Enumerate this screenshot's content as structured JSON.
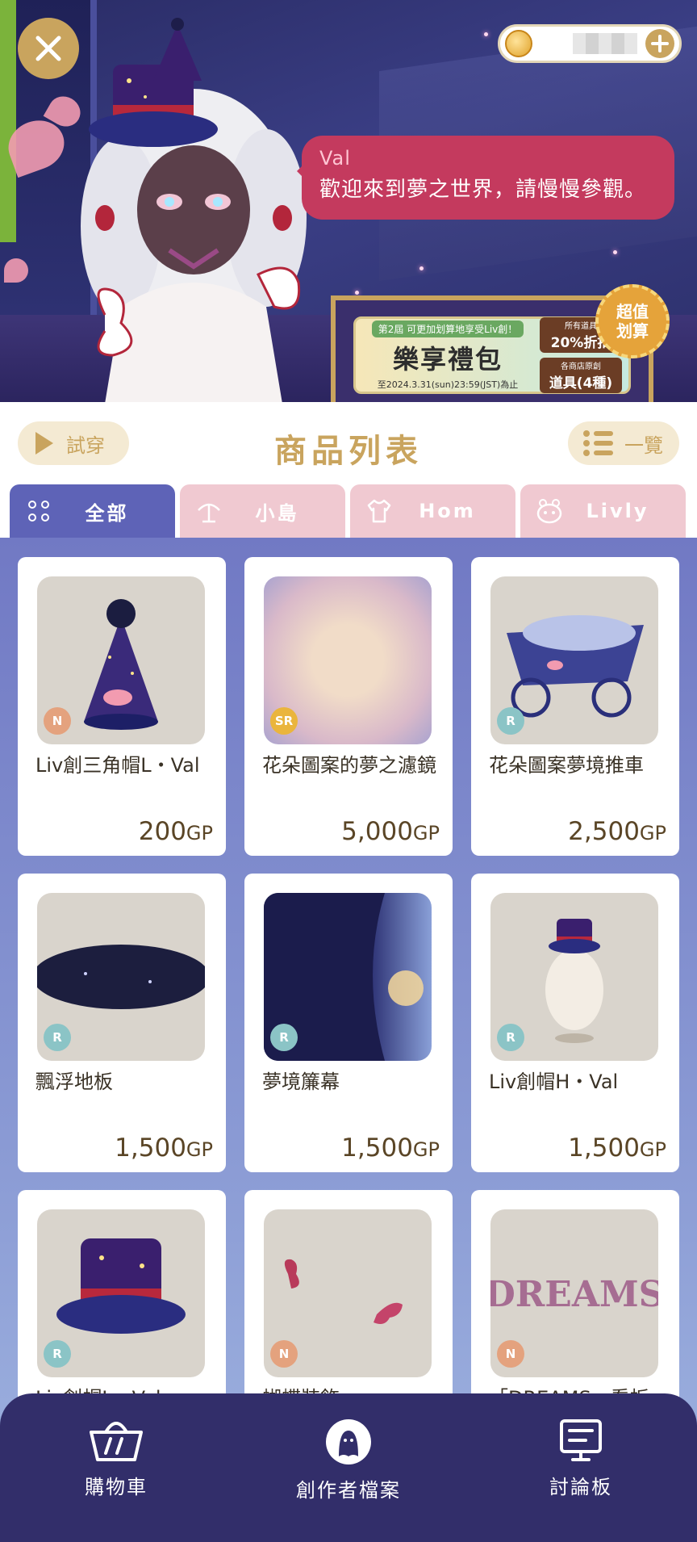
{
  "hero": {
    "speaker_name": "Val",
    "speech_text": "歡迎來到夢之世界，請慢慢參觀。",
    "close_icon": "close-icon",
    "coin_icon": "coin-icon",
    "plus_icon": "plus-icon"
  },
  "promo": {
    "tag": "第2屆 可更加划算地享受Liv創！",
    "title": "樂享禮包",
    "date": "至2024.3.31(sun)23:59(JST)為止",
    "box1_small": "所有道具",
    "box1_big": "20%折扣",
    "box2_small": "各商店原創",
    "box2_big": "道具(4種)",
    "badge_line1": "超值",
    "badge_line2": "划算"
  },
  "header": {
    "tryon_label": "試穿",
    "title": "商品列表",
    "listview_label": "一覽"
  },
  "tabs": [
    {
      "label": "全部",
      "icon": "grid-dots-icon",
      "active": true
    },
    {
      "label": "小島",
      "icon": "island-icon",
      "active": false
    },
    {
      "label": "Hom",
      "icon": "shirt-icon",
      "active": false
    },
    {
      "label": "Livly",
      "icon": "livly-face-icon",
      "active": false
    }
  ],
  "products": [
    {
      "name": "Liv創三角帽L・Val",
      "rarity": "N",
      "price": "200",
      "unit": "GP"
    },
    {
      "name": "花朵圖案的夢之濾鏡",
      "rarity": "SR",
      "price": "5,000",
      "unit": "GP"
    },
    {
      "name": "花朵圖案夢境推車",
      "rarity": "R",
      "price": "2,500",
      "unit": "GP"
    },
    {
      "name": "飄浮地板",
      "rarity": "R",
      "price": "1,500",
      "unit": "GP"
    },
    {
      "name": "夢境簾幕",
      "rarity": "R",
      "price": "1,500",
      "unit": "GP"
    },
    {
      "name": "Liv創帽H・Val",
      "rarity": "R",
      "price": "1,500",
      "unit": "GP"
    },
    {
      "name": "Liv創帽L・Val",
      "rarity": "R",
      "price": "",
      "unit": ""
    },
    {
      "name": "蝴蝶裝飾",
      "rarity": "N",
      "price": "",
      "unit": ""
    },
    {
      "name": "「DREAMS」看板",
      "rarity": "N",
      "price": "",
      "unit": ""
    }
  ],
  "dreams_sign_text": "DREAMS",
  "colors": {
    "gold": "#c9a45e",
    "tab_active": "#5e63b7",
    "tab_inactive": "#f0c9d1",
    "rarity_N": "#e4a27e",
    "rarity_SR": "#eab53d",
    "rarity_R": "#8bc4c6",
    "nav_bg": "#322e6a",
    "speech_bg": "#c43a5e"
  },
  "nav": {
    "cart_label": "購物車",
    "creator_label": "創作者檔案",
    "forum_label": "討論板"
  }
}
